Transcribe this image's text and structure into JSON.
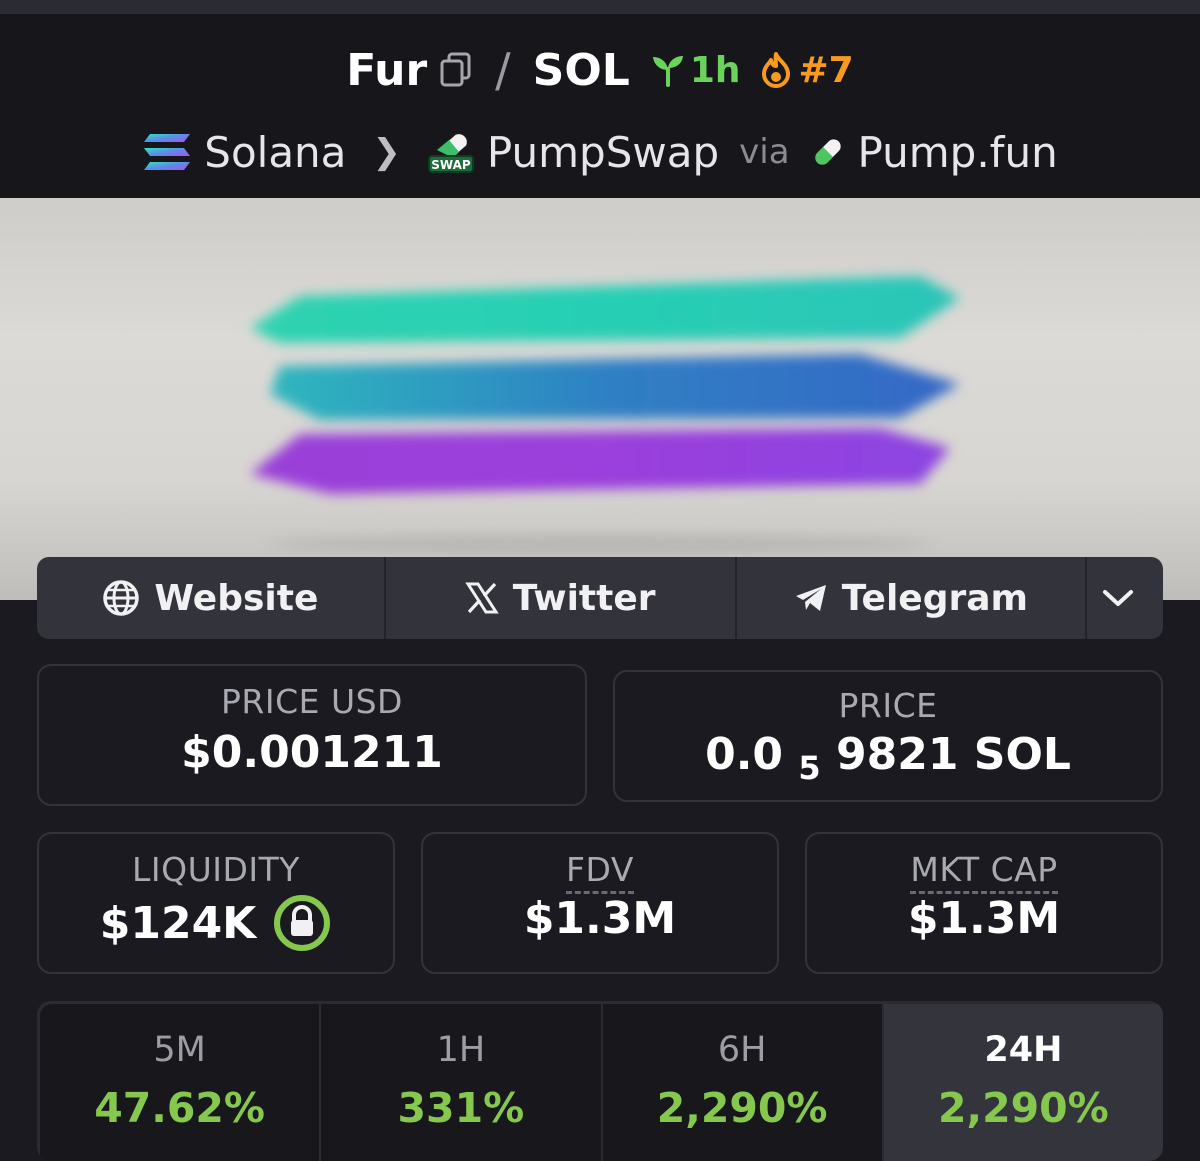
{
  "pair": {
    "base": "Fur",
    "quote": "SOL",
    "separator": "/",
    "age": "1h",
    "rank": "#7"
  },
  "route": {
    "chain": "Solana",
    "dex": "PumpSwap",
    "dex_badge": "SWAP",
    "via": "via",
    "launchpad": "Pump.fun"
  },
  "links": {
    "website": "Website",
    "twitter": "Twitter",
    "telegram": "Telegram"
  },
  "metrics": {
    "price_usd_label": "PRICE USD",
    "price_usd": "$0.001211",
    "price_label": "PRICE",
    "price_prefix": "0.0",
    "price_zeros": "5",
    "price_suffix": "9821 SOL",
    "liquidity_label": "LIQUIDITY",
    "liquidity": "$124K",
    "fdv_label": "FDV",
    "fdv": "$1.3M",
    "mktcap_label": "MKT CAP",
    "mktcap": "$1.3M"
  },
  "changes": [
    {
      "label": "5M",
      "value": "47.62%"
    },
    {
      "label": "1H",
      "value": "331%"
    },
    {
      "label": "6H",
      "value": "2,290%"
    },
    {
      "label": "24H",
      "value": "2,290%"
    }
  ],
  "colors": {
    "positive": "#86c84e",
    "age": "#6bd35a",
    "rank": "#f79a1e"
  }
}
